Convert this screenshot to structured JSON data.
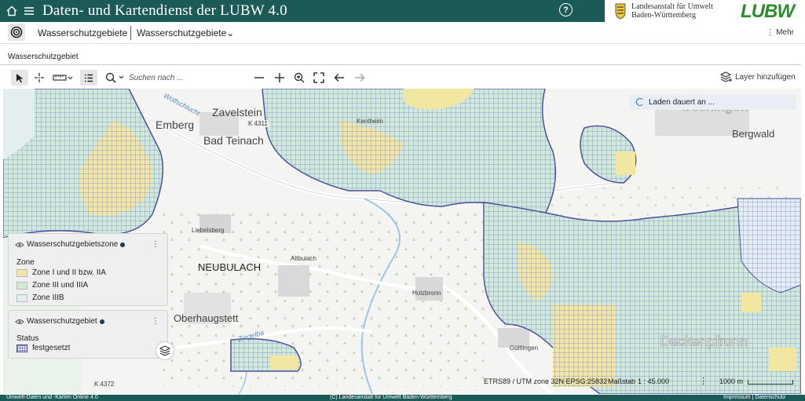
{
  "header": {
    "title": "Daten- und Kartendienst der LUBW 4.0",
    "home_icon": "home-icon",
    "menu_icon": "hamburger-menu-icon",
    "help_icon": "help-icon",
    "help_glyph": "?",
    "logo_line1": "Landesanstalt für Umwelt",
    "logo_line2": "Baden-Württemberg",
    "logo_brand": "LUBW",
    "brand_color": "#1b5a57"
  },
  "nav": {
    "target_icon": "target-icon",
    "breadcrumb1": "Wasserschutzgebiete",
    "breadcrumb2": "Wasserschutzgebiete",
    "breadcrumb2_caret": "⌄",
    "more_icon": "vertical-dots-icon",
    "more_label": "⋮  Mehr"
  },
  "tab": {
    "label": "Wasserschutzgebiet"
  },
  "toolbar": {
    "select_icon": "cursor-arrow-icon",
    "coordinate_icon": "crosshair-icon",
    "measure_icon": "ruler-icon",
    "list_icon": "list-icon",
    "search_icon": "magnifier-icon",
    "search_placeholder": "Suchen nach ...",
    "zoom_out_icon": "minus-icon",
    "zoom_in_icon": "plus-icon",
    "zoom_area_icon": "zoom-magnifier-icon",
    "fullscreen_icon": "fullscreen-icon",
    "back_icon": "arrow-left-icon",
    "forward_icon": "arrow-right-icon",
    "add_layer_icon": "layers-icon",
    "add_layer_label": "Layer hinzufügen"
  },
  "map": {
    "loading_text": "Laden dauert an ...",
    "places": {
      "zavelstein": "Zavelstein",
      "emberg": "Emberg",
      "bad_teinach": "Bad Teinach",
      "neubulach": "NEUBULACH",
      "oberhaugstett": "Oberhaugstett",
      "liebelsberg": "Liebelsberg",
      "altbulach": "Altbulach",
      "holzbronn": "Holzbronn",
      "gultlingen": "Gültlingen",
      "kentheim": "Kentheim",
      "geclingen": "Gechingen",
      "bergwald": "Bergwald",
      "deckenpfronn": "Deckenpfronn",
      "k4311": "K 4311",
      "k4372": "K 4372",
      "wolfschlucht": "Wolfschlucht",
      "ziegelba": "Ziegelba"
    },
    "zone_colors": {
      "zone1": "#f2e7a0",
      "zone3": "#cfead6",
      "zone3b": "#e4eef0",
      "border": "#4b4f9a"
    }
  },
  "legend": {
    "layer1_title": "Wasserschutzgebietszone",
    "layer1_sub": "Zone",
    "layer1_items": [
      "Zone I und II bzw. IIA",
      "Zone III und IIIA",
      "Zone IIIB"
    ],
    "layer2_title": "Wasserschutzgebiet",
    "layer2_sub": "Status",
    "layer2_items": [
      "festgesetzt"
    ],
    "menu_glyph": "⋮",
    "visibility_icon": "eye-icon",
    "layers_button_icon": "layers-stack-icon"
  },
  "status": {
    "crs": "ETRS89 / UTM zone 32N EPSG:25832",
    "scale_label": "Maßstab",
    "scale_value": "1 : 45.000",
    "menu_glyph": "⋮",
    "scalebar_label": "1000 m"
  },
  "footer": {
    "left": "Umwelt-Daten und -Karten Online 4.0",
    "center": "(C) Landesanstalt für Umwelt Baden-Württemberg",
    "right": "Impressum | Datenschutz"
  }
}
